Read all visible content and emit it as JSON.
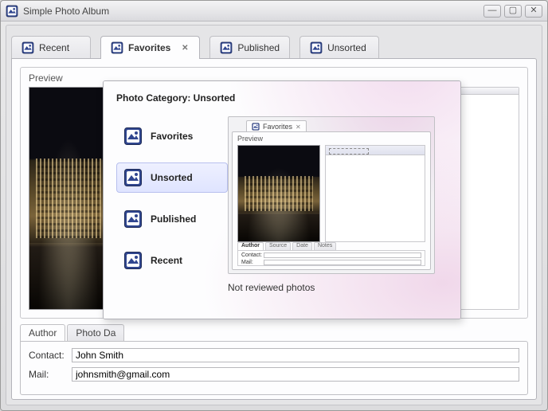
{
  "window": {
    "title": "Simple Photo Album"
  },
  "tabs": [
    {
      "label": "Recent"
    },
    {
      "label": "Favorites"
    },
    {
      "label": "Published"
    },
    {
      "label": "Unsorted"
    }
  ],
  "preview": {
    "label": "Preview",
    "columns": {
      "col1": "",
      "col2": ""
    }
  },
  "bottom_tabs": [
    {
      "label": "Author"
    },
    {
      "label": "Photo Da"
    }
  ],
  "author_form": {
    "contact_label": "Contact:",
    "contact_value": "John Smith",
    "mail_label": "Mail:",
    "mail_value": "johnsmith@gmail.com"
  },
  "popover": {
    "title_prefix": "Photo Category: ",
    "title_value": "Unsorted",
    "categories": [
      {
        "label": "Favorites"
      },
      {
        "label": "Unsorted"
      },
      {
        "label": "Published"
      },
      {
        "label": "Recent"
      }
    ],
    "caption": "Not reviewed photos",
    "mini": {
      "tab_label": "Favorites",
      "preview_label": "Preview",
      "bottom_tabs": [
        "Author",
        "Source",
        "Date",
        "Notes"
      ],
      "contact_label": "Contact:",
      "mail_label": "Mail:"
    }
  }
}
